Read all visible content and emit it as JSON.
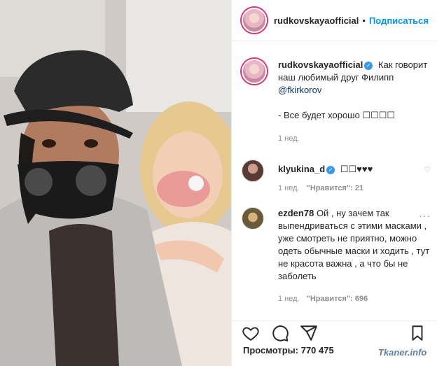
{
  "header": {
    "username": "rudkovskayaofficial",
    "follow_label": "Подписаться"
  },
  "caption": {
    "username": "rudkovskayaofficial",
    "text": "Как говорит наш любимый друг Филипп",
    "mention": "@fkirkorov",
    "line2": "- Все будет хорошо ☐☐☐☐",
    "time": "1 нед."
  },
  "comments": [
    {
      "username": "klyukina_d",
      "text": "☐☐♥♥♥",
      "time": "1 нед.",
      "likes": "\"Нравится\": 21"
    },
    {
      "username": "ezden78",
      "text": "Ой , ну зачем так выпендриваться с этими масками , уже смотреть не приятно, можно одеть обычные маски и ходить , тут не красота важна , а что бы не заболеть",
      "time": "1 нед.",
      "likes": "\"Нравится\": 696"
    }
  ],
  "views": {
    "label": "Просмотры:",
    "count": "770 475"
  },
  "watermark": "Tkaner.info",
  "icons": {
    "like": "heart-icon",
    "comment": "comment-icon",
    "share": "share-icon",
    "verified": "verified-icon"
  },
  "colors": {
    "accent": "#0095f6",
    "verified": "#3897f0"
  }
}
